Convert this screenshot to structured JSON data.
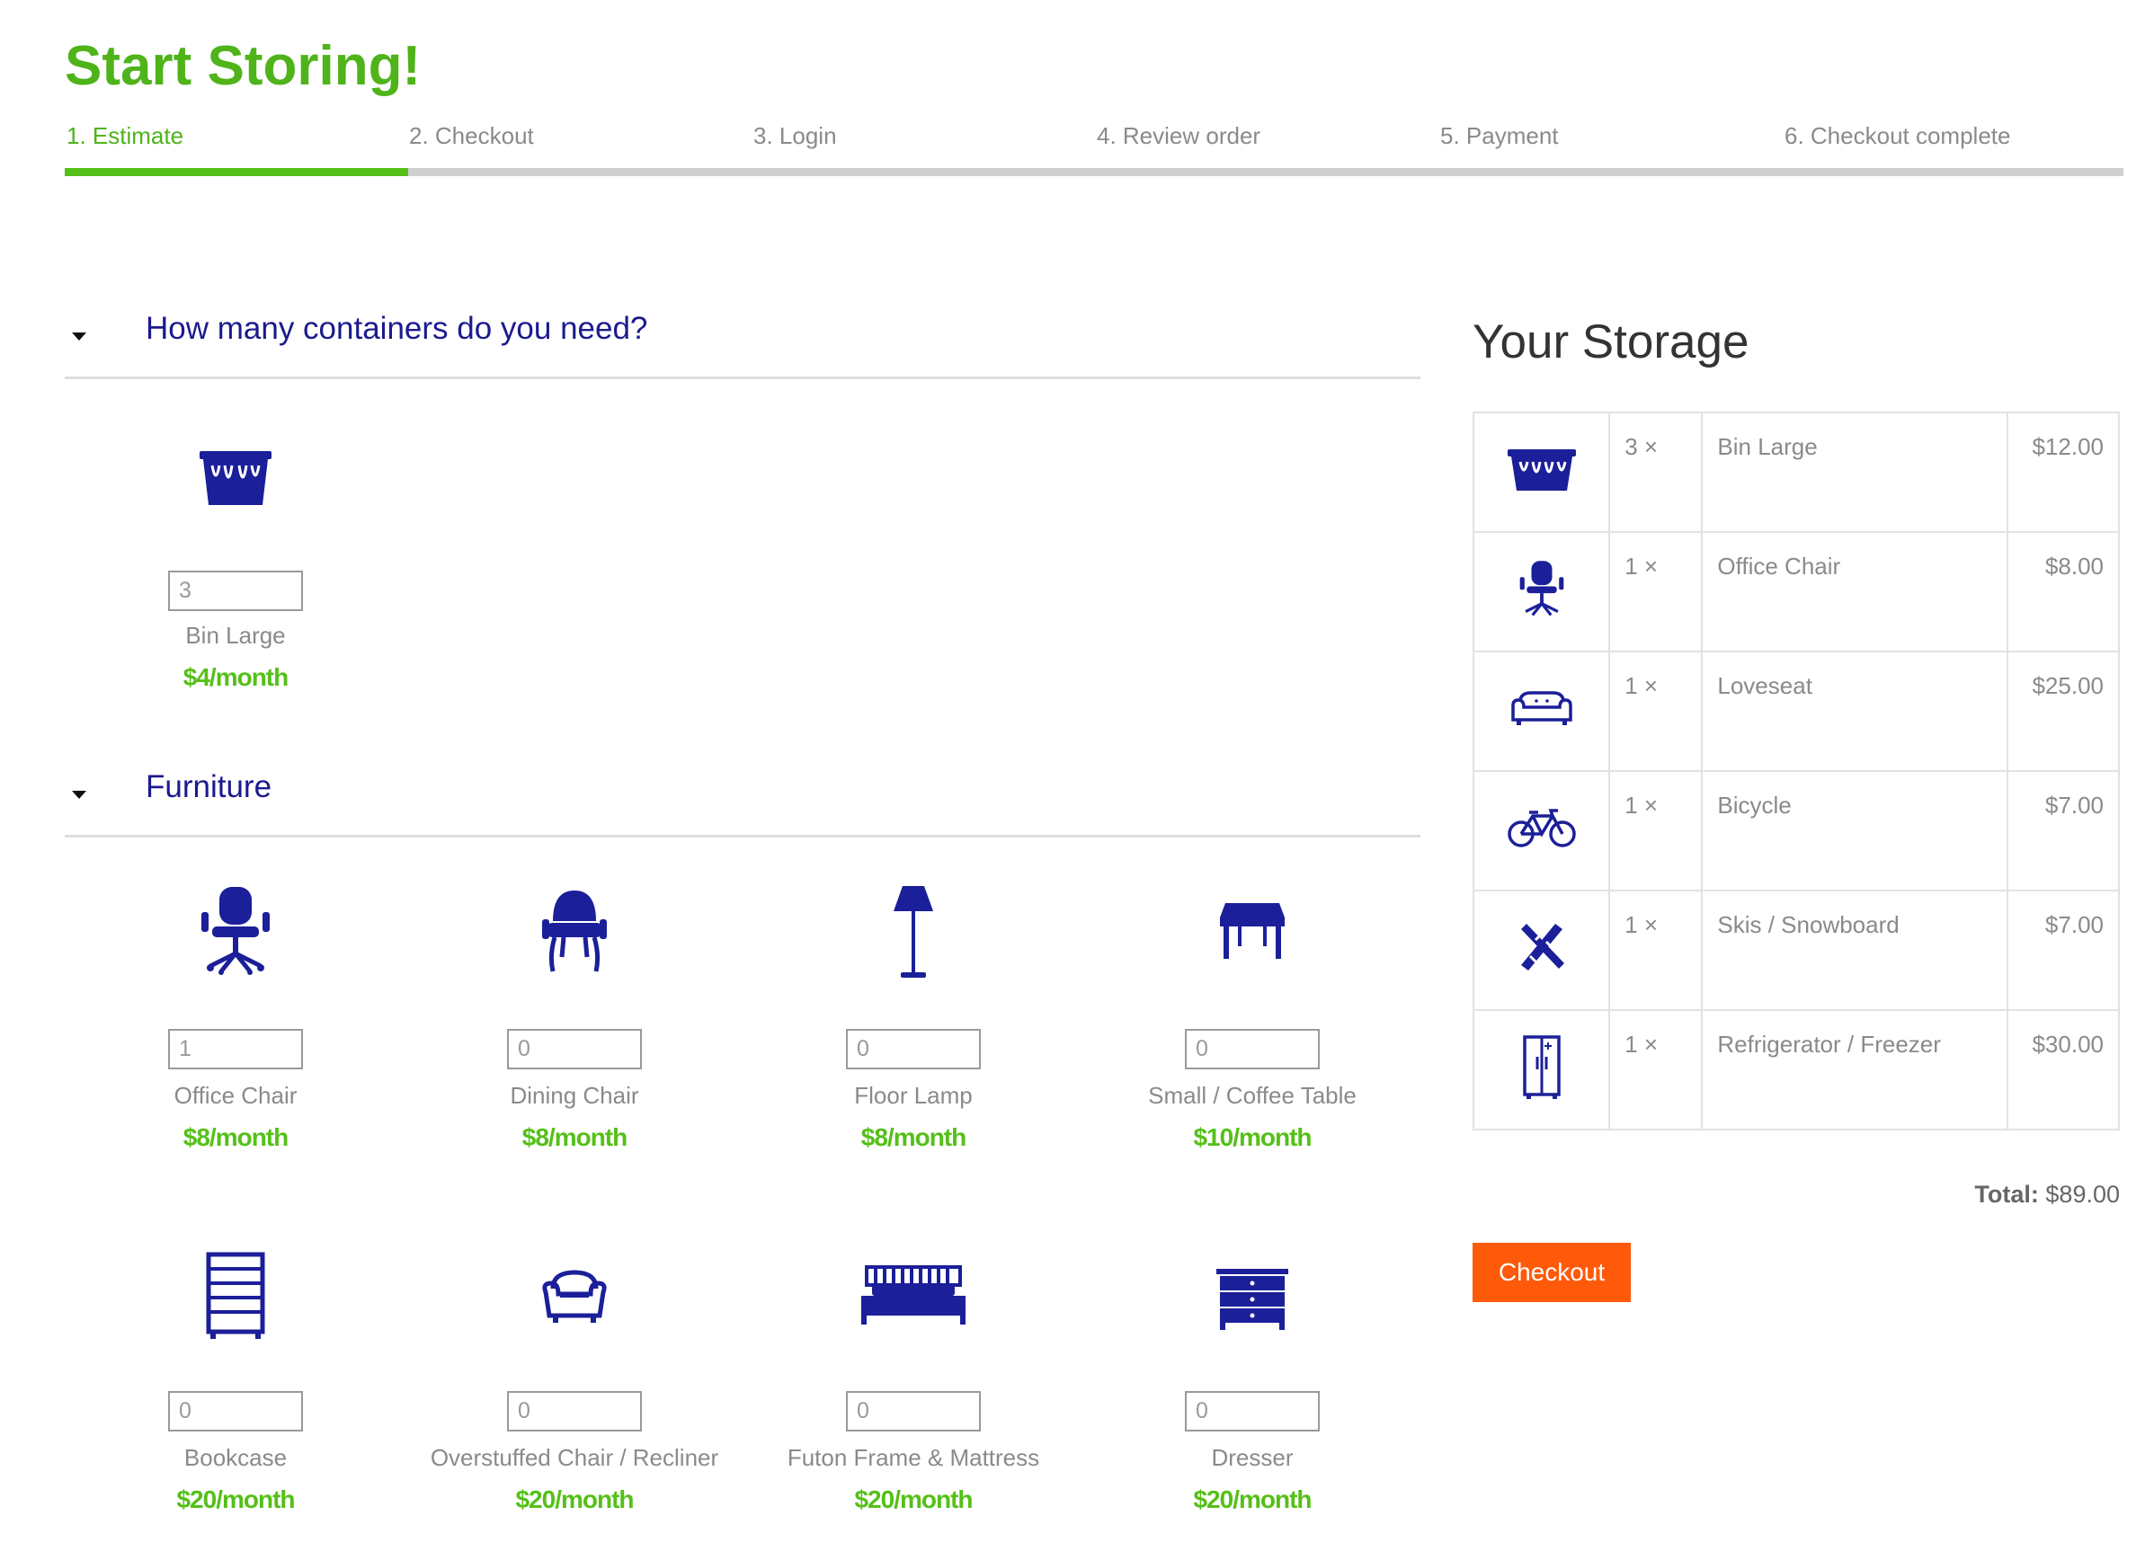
{
  "page": {
    "title": "Start Storing!"
  },
  "steps": [
    {
      "label": "1. Estimate",
      "active": true
    },
    {
      "label": "2. Checkout"
    },
    {
      "label": "3. Login"
    },
    {
      "label": "4. Review order"
    },
    {
      "label": "5. Payment"
    },
    {
      "label": "6. Checkout complete"
    }
  ],
  "progress": {
    "current_step": 1,
    "total_steps": 6
  },
  "sections": {
    "containers": {
      "title": "How many containers do you need?",
      "items": [
        {
          "icon": "bin-icon",
          "qty": "3",
          "name": "Bin Large",
          "price": "$4/month"
        }
      ]
    },
    "furniture": {
      "title": "Furniture",
      "items": [
        {
          "icon": "office-chair-icon",
          "qty": "1",
          "name": "Office Chair",
          "price": "$8/month"
        },
        {
          "icon": "dining-chair-icon",
          "qty": "0",
          "name": "Dining Chair",
          "price": "$8/month"
        },
        {
          "icon": "floor-lamp-icon",
          "qty": "0",
          "name": "Floor Lamp",
          "price": "$8/month"
        },
        {
          "icon": "coffee-table-icon",
          "qty": "0",
          "name": "Small / Coffee Table",
          "price": "$10/month"
        },
        {
          "icon": "bookcase-icon",
          "qty": "0",
          "name": "Bookcase",
          "price": "$20/month"
        },
        {
          "icon": "armchair-icon",
          "qty": "0",
          "name": "Overstuffed Chair / Recliner",
          "price": "$20/month"
        },
        {
          "icon": "bed-icon",
          "qty": "0",
          "name": "Futon Frame & Mattress",
          "price": "$20/month"
        },
        {
          "icon": "dresser-icon",
          "qty": "0",
          "name": "Dresser",
          "price": "$20/month"
        }
      ]
    }
  },
  "storage": {
    "title": "Your Storage",
    "rows": [
      {
        "icon": "bin-icon",
        "qty": "3 ×",
        "name": "Bin Large",
        "price": "$12.00"
      },
      {
        "icon": "office-chair-icon",
        "qty": "1 ×",
        "name": "Office Chair",
        "price": "$8.00"
      },
      {
        "icon": "sofa-icon",
        "qty": "1 ×",
        "name": "Loveseat",
        "price": "$25.00"
      },
      {
        "icon": "bicycle-icon",
        "qty": "1 ×",
        "name": "Bicycle",
        "price": "$7.00"
      },
      {
        "icon": "skis-icon",
        "qty": "1 ×",
        "name": "Skis / Snowboard",
        "price": "$7.00"
      },
      {
        "icon": "refrigerator-icon",
        "qty": "1 ×",
        "name": "Refrigerator / Freezer",
        "price": "$30.00"
      }
    ],
    "total_label": "Total:",
    "total_value": "$89.00",
    "checkout_label": "Checkout"
  },
  "colors": {
    "accent_green": "#55c018",
    "title_green": "#4fb31a",
    "navy": "#1b1a8e",
    "icon_blue": "#1b1f99",
    "checkout_orange": "#ff5a09"
  }
}
